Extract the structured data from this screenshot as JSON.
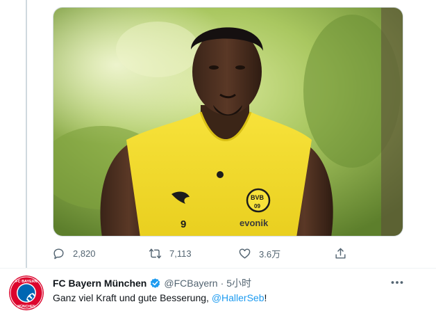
{
  "colors": {
    "accent": "#1d9bf0",
    "muted": "#536471",
    "bayern_red": "#dc052d",
    "bayern_blue": "#0066b2",
    "jersey": "#f5df2e"
  },
  "photo": {
    "jersey_number": "9",
    "crest_text": "BVB",
    "crest_year": "09",
    "sponsor": "evonik",
    "kit_brand": "puma"
  },
  "actions": {
    "reply_icon": "reply-icon",
    "reply_count": "2,820",
    "retweet_icon": "retweet-icon",
    "retweet_count": "7,113",
    "like_icon": "heart-icon",
    "like_count": "3.6万",
    "share_icon": "share-icon"
  },
  "tweet": {
    "avatar_text_top": "FC BAYERN",
    "avatar_text_bottom": "MÜNCHEN",
    "display_name": "FC Bayern München",
    "handle": "@FCBayern",
    "separator": "·",
    "time": "5小时",
    "text_prefix": "Ganz viel Kraft und gute Besserung, ",
    "mention": "@HallerSeb",
    "text_suffix": "!"
  }
}
